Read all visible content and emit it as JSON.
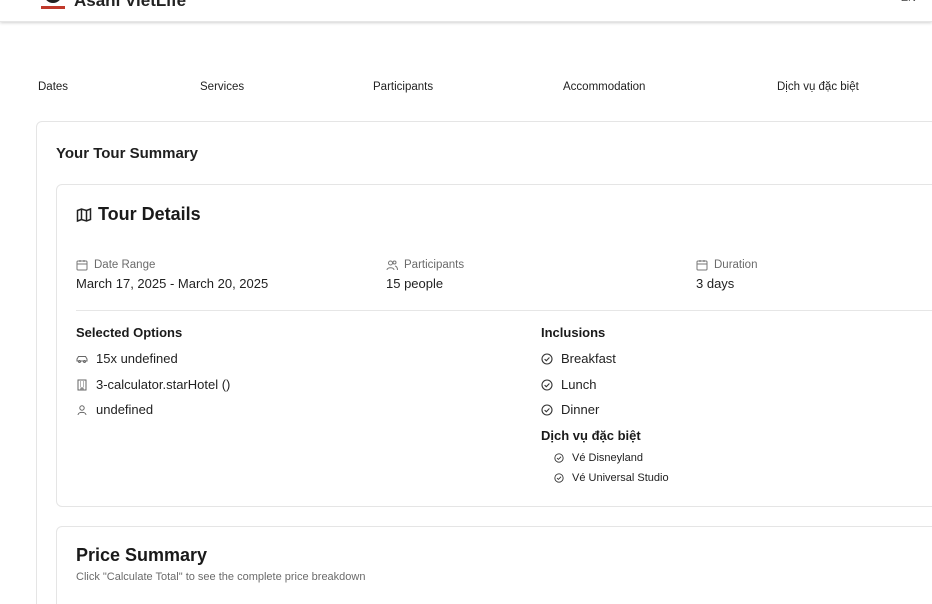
{
  "header": {
    "brand": "Asahi VietLife",
    "language": "EN"
  },
  "steps": [
    "Dates",
    "Services",
    "Participants",
    "Accommodation",
    "Dịch vụ đặc biệt"
  ],
  "summary": {
    "title": "Your Tour Summary"
  },
  "tour_details": {
    "title": "Tour Details",
    "date_range": {
      "label": "Date Range",
      "value": "March 17, 2025 - March 20, 2025"
    },
    "participants": {
      "label": "Participants",
      "value": "15 people"
    },
    "duration": {
      "label": "Duration",
      "value": "3 days"
    },
    "selected_options": {
      "title": "Selected Options",
      "items": [
        "15x undefined",
        "3-calculator.starHotel ()",
        "undefined"
      ],
      "icons": [
        "car-icon",
        "building-icon",
        "user-icon"
      ]
    },
    "inclusions": {
      "title": "Inclusions",
      "items": [
        "Breakfast",
        "Lunch",
        "Dinner"
      ]
    },
    "special_services": {
      "title": "Dịch vụ đặc biệt",
      "items": [
        "Vé Disneyland",
        "Vé Universal Studio"
      ]
    }
  },
  "price_summary": {
    "title": "Price Summary",
    "hint": "Click \"Calculate Total\" to see the complete price breakdown"
  }
}
